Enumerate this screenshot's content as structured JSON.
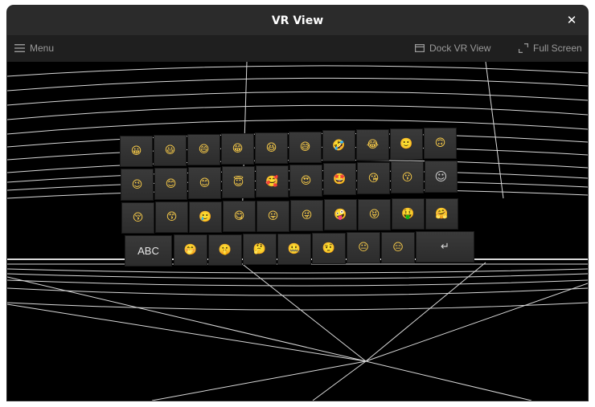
{
  "window": {
    "title": "VR View",
    "close_glyph": "✕"
  },
  "toolbar": {
    "menu_label": "Menu",
    "menu_icon": "hamburger-icon",
    "dock_label": "Dock VR View",
    "dock_icon": "dock-window-icon",
    "fullscreen_label": "Full Screen",
    "fullscreen_icon": "expand-corners-icon"
  },
  "keyboard": {
    "rows": [
      [
        "😀",
        "😃",
        "😄",
        "😁",
        "😆",
        "😅",
        "🤣",
        "😂",
        "🙂",
        "🙃"
      ],
      [
        "😉",
        "😊",
        "😊",
        "😇",
        "🥰",
        "😍",
        "🤩",
        "😘",
        "😗",
        "☺"
      ],
      [
        "😚",
        "😙",
        "🥲",
        "😋",
        "😛",
        "😜",
        "🤪",
        "😝",
        "🤑",
        "🤗"
      ],
      [
        "ABC",
        "🤭",
        "🤫",
        "🤔",
        "🤐",
        "🤨",
        "😐",
        "😑",
        "↵"
      ]
    ]
  },
  "colors": {
    "titlebar_bg": "#2b2b2b",
    "toolbar_bg": "#1f1f1f",
    "viewport_bg": "#000000",
    "grid_line": "#ffffff",
    "key_bg": "#333333",
    "emoji_yellow": "#ffd04a"
  }
}
